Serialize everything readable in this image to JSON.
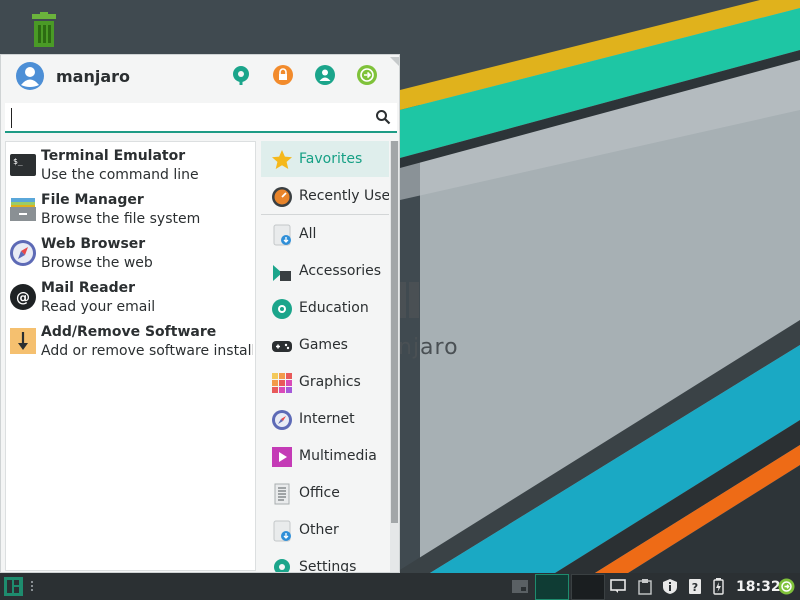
{
  "user": {
    "name": "manjaro"
  },
  "header": {
    "buttons": [
      {
        "icon": "settings-manager-icon",
        "color": "#1ba58b"
      },
      {
        "icon": "lock-screen-icon",
        "color": "#f28b2c"
      },
      {
        "icon": "switch-user-icon",
        "color": "#1ba58b"
      },
      {
        "icon": "log-out-icon",
        "color": "#7fc23a"
      }
    ]
  },
  "search": {
    "value": "",
    "placeholder": ""
  },
  "apps": [
    {
      "title": "Terminal Emulator",
      "desc": "Use the command line",
      "icon": "terminal-icon"
    },
    {
      "title": "File Manager",
      "desc": "Browse the file system",
      "icon": "file-manager-icon"
    },
    {
      "title": "Web Browser",
      "desc": "Browse the web",
      "icon": "web-browser-icon"
    },
    {
      "title": "Mail Reader",
      "desc": "Read your email",
      "icon": "mail-reader-icon"
    },
    {
      "title": "Add/Remove Software",
      "desc": "Add or remove software installe...",
      "icon": "software-install-icon"
    }
  ],
  "categories": [
    {
      "label": "Favorites",
      "icon": "star-icon",
      "selected": true
    },
    {
      "label": "Recently Used",
      "icon": "recent-icon"
    },
    {
      "label": "All",
      "icon": "all-apps-icon"
    },
    {
      "label": "Accessories",
      "icon": "accessories-icon"
    },
    {
      "label": "Education",
      "icon": "education-icon"
    },
    {
      "label": "Games",
      "icon": "gamepad-icon"
    },
    {
      "label": "Graphics",
      "icon": "graphics-icon"
    },
    {
      "label": "Internet",
      "icon": "internet-icon"
    },
    {
      "label": "Multimedia",
      "icon": "multimedia-icon"
    },
    {
      "label": "Office",
      "icon": "office-icon"
    },
    {
      "label": "Other",
      "icon": "other-icon"
    },
    {
      "label": "Settings",
      "icon": "settings-icon"
    }
  ],
  "desktop": {
    "brand_text": "njaro"
  },
  "panel": {
    "clock": "18:32"
  },
  "colors": {
    "accent": "#16a085",
    "panel": "#2b3033",
    "stripe_yellow": "#e0b21c",
    "stripe_teal": "#1ec6a4",
    "stripe_cyan": "#1aa9c4",
    "stripe_orange": "#ee6b16"
  }
}
